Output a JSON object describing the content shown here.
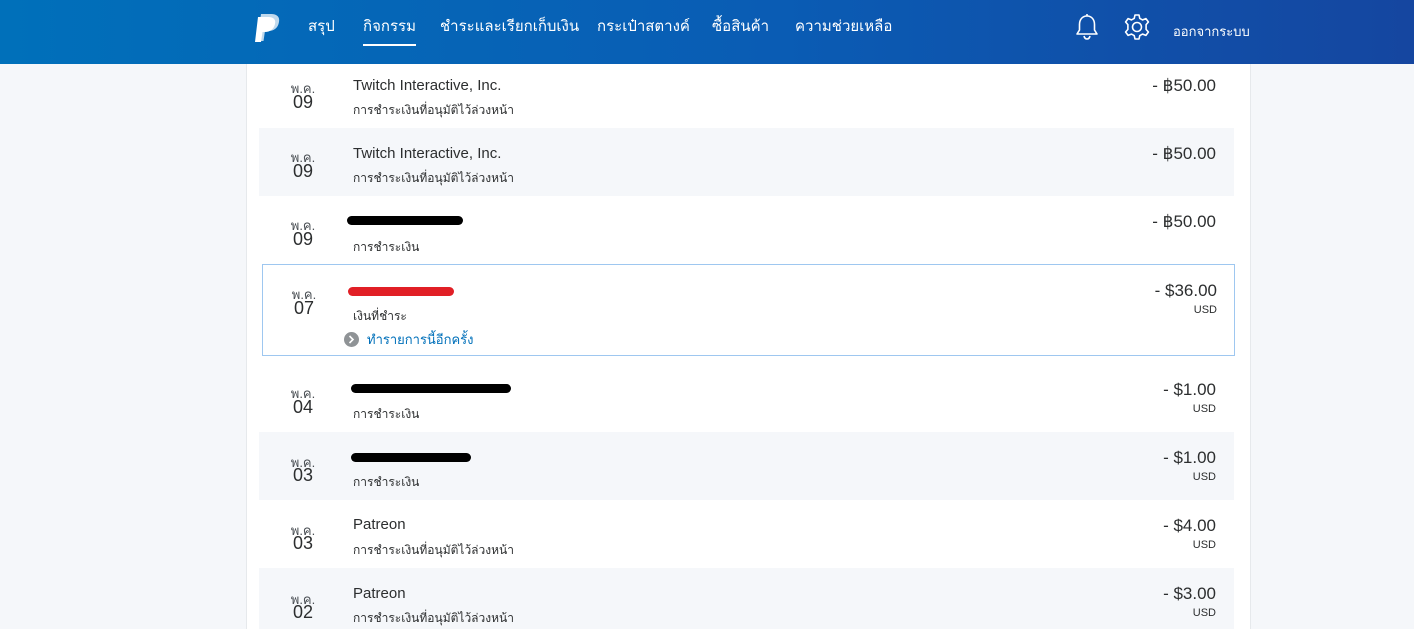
{
  "nav": {
    "logo_icon": "paypal-logo",
    "items": [
      {
        "label": "สรุป"
      },
      {
        "label": "กิจกรรม"
      },
      {
        "label": "ชำระและเรียกเก็บเงิน"
      },
      {
        "label": "กระเป๋าสตางค์"
      },
      {
        "label": "ซื้อสินค้า"
      },
      {
        "label": "ความช่วยเหลือ"
      }
    ],
    "active_index": 1,
    "bell_icon": "bell-icon",
    "gear_icon": "gear-icon",
    "logout_label": "ออกจากระบบ"
  },
  "colors": {
    "header_start": "#0070ba",
    "header_end": "#1546a0",
    "link": "#0070ba",
    "redaction_black": "#000000",
    "redaction_red": "#e11f26"
  },
  "transactions": [
    {
      "month": "พ.ค.",
      "day": "09",
      "name": "Twitch Interactive, Inc.",
      "description": "การชำระเงินที่อนุมัติไว้ล่วงหน้า",
      "amount": "- ฿50.00",
      "currency": ""
    },
    {
      "month": "พ.ค.",
      "day": "09",
      "name": "Twitch Interactive, Inc.",
      "description": "การชำระเงินที่อนุมัติไว้ล่วงหน้า",
      "amount": "- ฿50.00",
      "currency": ""
    },
    {
      "month": "พ.ค.",
      "day": "09",
      "name": "",
      "description": "การชำระเงิน",
      "amount": "- ฿50.00",
      "currency": ""
    },
    {
      "month": "พ.ค.",
      "day": "07",
      "name": "",
      "description": "เงินที่ชำระ",
      "amount": "- $36.00",
      "currency": "USD",
      "action_label": "ทำรายการนี้อีกครั้ง"
    },
    {
      "month": "พ.ค.",
      "day": "04",
      "name": "",
      "description": "การชำระเงิน",
      "amount": "- $1.00",
      "currency": "USD"
    },
    {
      "month": "พ.ค.",
      "day": "03",
      "name": "",
      "description": "การชำระเงิน",
      "amount": "- $1.00",
      "currency": "USD"
    },
    {
      "month": "พ.ค.",
      "day": "03",
      "name": "Patreon",
      "description": "การชำระเงินที่อนุมัติไว้ล่วงหน้า",
      "amount": "- $4.00",
      "currency": "USD"
    },
    {
      "month": "พ.ค.",
      "day": "02",
      "name": "Patreon",
      "description": "การชำระเงินที่อนุมัติไว้ล่วงหน้า",
      "amount": "- $3.00",
      "currency": "USD"
    }
  ]
}
